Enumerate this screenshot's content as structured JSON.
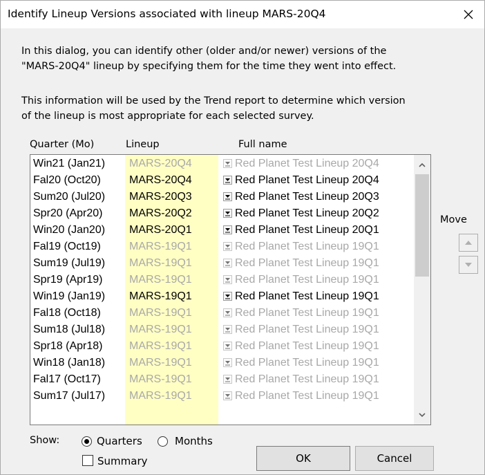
{
  "dialog": {
    "title": "Identify Lineup Versions associated with lineup MARS-20Q4",
    "description_lines": [
      "In this dialog, you can identify other (older and/or newer) versions of the",
      "\"MARS-20Q4\" lineup by specifying them for the time they went into effect.",
      "",
      "This information will be used by the Trend report to determine which version",
      "of the lineup is most appropriate for each selected survey."
    ]
  },
  "grid": {
    "columns": {
      "quarter": "Quarter (Mo)",
      "lineup": "Lineup",
      "fullname": "Full name"
    },
    "rows": [
      {
        "quarter": "Win21 (Jan21)",
        "lineup": "MARS-20Q4",
        "fullname": "Red Planet Test Lineup 20Q4",
        "active": false
      },
      {
        "quarter": "Fal20 (Oct20)",
        "lineup": "MARS-20Q4",
        "fullname": "Red Planet Test Lineup 20Q4",
        "active": true
      },
      {
        "quarter": "Sum20 (Jul20)",
        "lineup": "MARS-20Q3",
        "fullname": "Red Planet Test Lineup 20Q3",
        "active": true
      },
      {
        "quarter": "Spr20 (Apr20)",
        "lineup": "MARS-20Q2",
        "fullname": "Red Planet Test Lineup 20Q2",
        "active": true
      },
      {
        "quarter": "Win20 (Jan20)",
        "lineup": "MARS-20Q1",
        "fullname": "Red Planet Test Lineup 20Q1",
        "active": true
      },
      {
        "quarter": "Fal19 (Oct19)",
        "lineup": "MARS-19Q1",
        "fullname": "Red Planet Test Lineup 19Q1",
        "active": false
      },
      {
        "quarter": "Sum19 (Jul19)",
        "lineup": "MARS-19Q1",
        "fullname": "Red Planet Test Lineup 19Q1",
        "active": false
      },
      {
        "quarter": "Spr19 (Apr19)",
        "lineup": "MARS-19Q1",
        "fullname": "Red Planet Test Lineup 19Q1",
        "active": false
      },
      {
        "quarter": "Win19 (Jan19)",
        "lineup": "MARS-19Q1",
        "fullname": "Red Planet Test Lineup 19Q1",
        "active": true
      },
      {
        "quarter": "Fal18 (Oct18)",
        "lineup": "MARS-19Q1",
        "fullname": "Red Planet Test Lineup 19Q1",
        "active": false
      },
      {
        "quarter": "Sum18 (Jul18)",
        "lineup": "MARS-19Q1",
        "fullname": "Red Planet Test Lineup 19Q1",
        "active": false
      },
      {
        "quarter": "Spr18 (Apr18)",
        "lineup": "MARS-19Q1",
        "fullname": "Red Planet Test Lineup 19Q1",
        "active": false
      },
      {
        "quarter": "Win18 (Jan18)",
        "lineup": "MARS-19Q1",
        "fullname": "Red Planet Test Lineup 19Q1",
        "active": false
      },
      {
        "quarter": "Fal17 (Oct17)",
        "lineup": "MARS-19Q1",
        "fullname": "Red Planet Test Lineup 19Q1",
        "active": false
      },
      {
        "quarter": "Sum17 (Jul17)",
        "lineup": "MARS-19Q1",
        "fullname": "Red Planet Test Lineup 19Q1",
        "active": false
      }
    ]
  },
  "move": {
    "label": "Move"
  },
  "show": {
    "label": "Show:",
    "quarters_label": "Quarters",
    "months_label": "Months",
    "summary_label": "Summary",
    "selected": "Quarters",
    "summary_checked": false
  },
  "buttons": {
    "ok": "OK",
    "cancel": "Cancel"
  },
  "colors": {
    "lineup_column_bg": "#ffffc4",
    "dim_text": "#a8a8a8"
  }
}
